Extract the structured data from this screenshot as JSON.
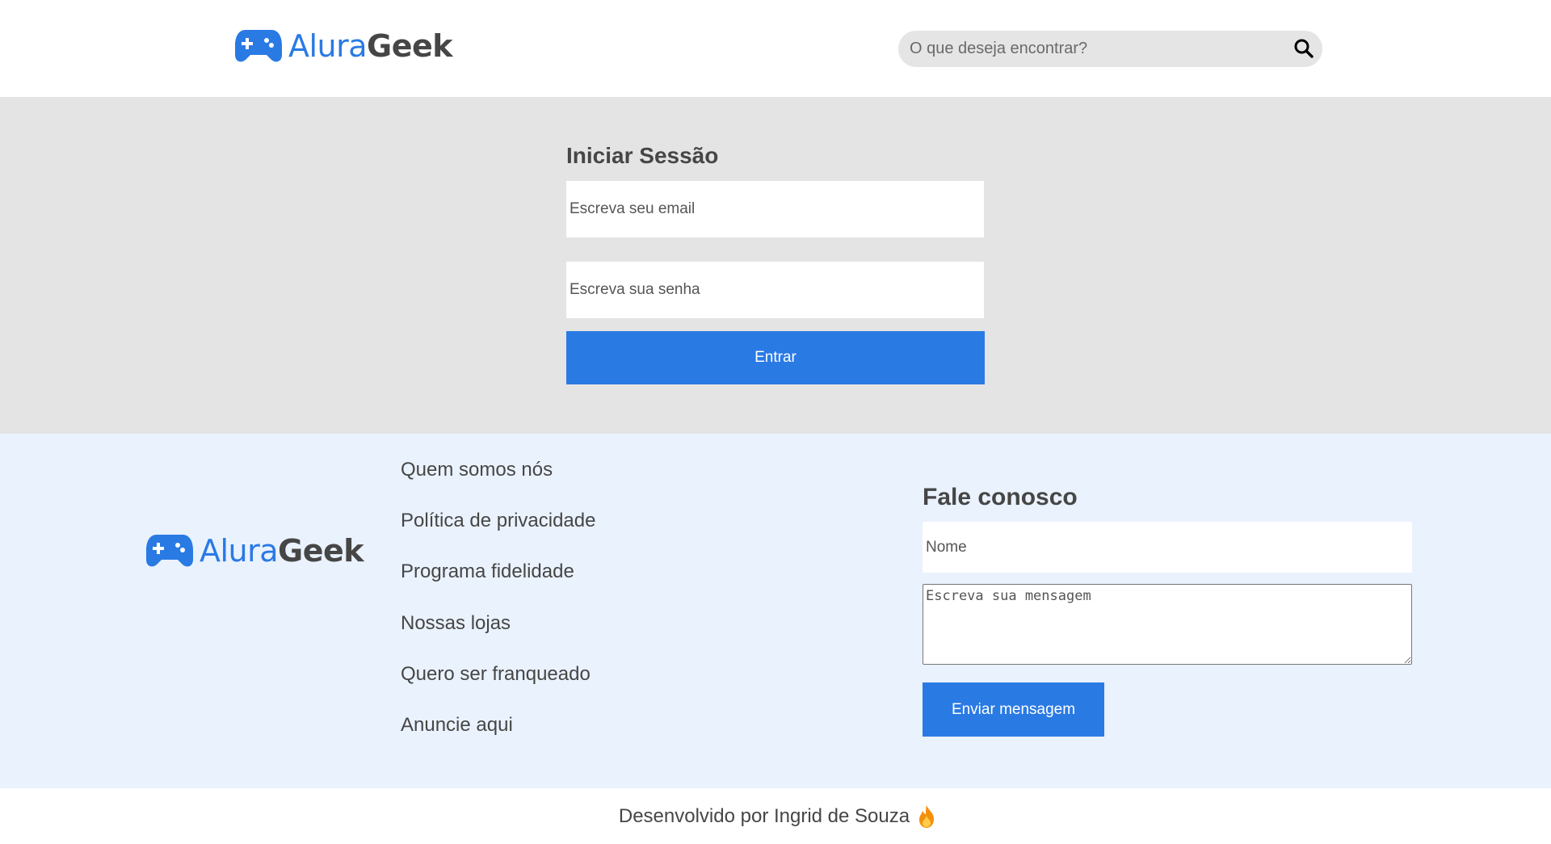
{
  "header": {
    "logo": {
      "part1": "Alura",
      "part2": "Geek"
    },
    "search": {
      "placeholder": "O que deseja encontrar?"
    }
  },
  "login": {
    "title": "Iniciar Sessão",
    "email_placeholder": "Escreva seu email",
    "password_placeholder": "Escreva sua senha",
    "submit_label": "Entrar"
  },
  "footer": {
    "logo": {
      "part1": "Alura",
      "part2": "Geek"
    },
    "links": [
      "Quem somos nós",
      "Política de privacidade",
      "Programa fidelidade",
      "Nossas lojas",
      "Quero ser franqueado",
      "Anuncie aqui"
    ],
    "contact": {
      "title": "Fale conosco",
      "name_placeholder": "Nome",
      "message_placeholder": "Escreva sua mensagem",
      "submit_label": "Enviar mensagem"
    }
  },
  "credit": {
    "text": "Desenvolvido por Ingrid de Souza",
    "icon": "fire-icon"
  },
  "colors": {
    "accent": "#2a7ae4",
    "text": "#464646",
    "login_bg": "#e4e4e4",
    "footer_bg": "#eaf2fd",
    "search_bg": "#e5e5e5"
  }
}
